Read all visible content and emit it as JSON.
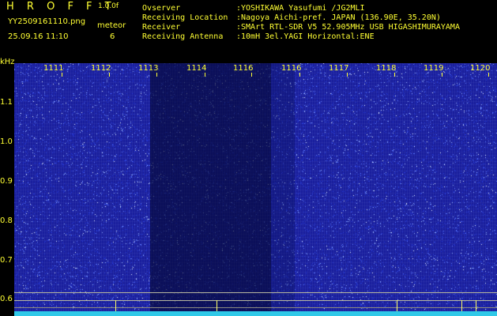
{
  "header": {
    "brand": "H R O F F T",
    "version": "1.0.0f",
    "filename": "YY2509161110.png",
    "mode": "meteor",
    "datetime": "25.09.16 11:10",
    "count": "6"
  },
  "info": [
    {
      "label": "Ovserver",
      "value": ":YOSHIKAWA Yasufumi /JG2MLI"
    },
    {
      "label": "Receiving Location",
      "value": ":Nagoya Aichi-pref. JAPAN (136.90E, 35.20N)"
    },
    {
      "label": "Receiver",
      "value": ":SMArt RTL-SDR V5 52.905MHz USB HIGASHIMURAYAMA"
    },
    {
      "label": "Receiving Antenna",
      "value": ":10mH 3el.YAGI Horizontal:ENE"
    }
  ],
  "axis": {
    "y_unit": "kHz",
    "y_ticks": [
      "1.1",
      "1.0",
      "0.9",
      "0.8",
      "0.7",
      "0.6"
    ],
    "x_ticks": [
      "1111",
      "1112",
      "1113",
      "1114",
      "1116",
      "1116",
      "1117",
      "1118",
      "1119",
      "1120"
    ]
  },
  "colors": {
    "label": "#ffff33",
    "background": "#1a1f9e",
    "noise_floor": "#2fc9e8"
  }
}
